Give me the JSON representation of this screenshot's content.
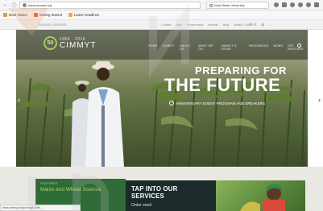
{
  "browser": {
    "url": "www.cimmyt.org",
    "search_placeholder": "Iowa State University",
    "bookmarks": [
      {
        "label": "Most Visited",
        "color": "#e9973a"
      },
      {
        "label": "Getting Started",
        "color": "#ea5a2f"
      },
      {
        "label": "Latest Headlines",
        "color": "#f1a73d"
      }
    ],
    "status_url": "www.cimmyt.org/cimmyt-50th..."
  },
  "topstrip": {
    "language": "ENGLISH / ESPAÑOL",
    "links": [
      "Contact",
      "Jobs",
      "Procurement",
      "Intranet",
      "Blog"
    ],
    "cta": "Initially: CIMMYT",
    "social": [
      "f",
      "t",
      "yt",
      "..."
    ]
  },
  "site": {
    "logo_years": "1966 - 2016",
    "logo_name": "CIMMYT",
    "logo_mark": "50",
    "menu": [
      "HOME",
      "CIMMYT",
      "ABOUT US",
      "WHAT WE DO",
      "CIMMYT & CGIAR",
      "RESOURCES",
      "NEWS",
      "GET INVOLVED"
    ]
  },
  "hero": {
    "line1": "PREPARING FOR",
    "line2": "THE FUTURE",
    "subtitle": "ANNIVERSARY EVENT PROGRAM AND SPEAKERS"
  },
  "cards": {
    "green_tag": "FEATURED",
    "green_title": "Maize and Wheat Science",
    "dark_title": "TAP INTO OUR SERVICES",
    "dark_sub": "Order seed"
  },
  "colors": {
    "accent_green": "#a5c85a",
    "card_green": "#2f6b37",
    "card_dark": "#1c2a2c"
  }
}
